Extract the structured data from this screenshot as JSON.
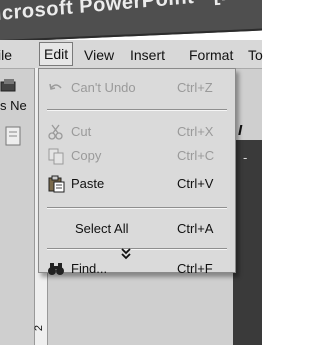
{
  "window": {
    "title": "icrosoft PowerPoint - [Presentat"
  },
  "menubar": {
    "items": [
      {
        "label": "ile"
      },
      {
        "label": "Edit"
      },
      {
        "label": "View"
      },
      {
        "label": "Insert"
      },
      {
        "label": "Format"
      },
      {
        "label": "To"
      }
    ]
  },
  "background": {
    "fragment_ne": "s Ne",
    "fragment_i": "I",
    "fragment_b": "b",
    "fragment_dash": "-",
    "ruler_digit": "2"
  },
  "edit_menu": {
    "items": [
      {
        "label": "Can't Undo",
        "shortcut": "Ctrl+Z",
        "enabled": false,
        "icon": "undo-icon"
      },
      {
        "label": "Cut",
        "shortcut": "Ctrl+X",
        "enabled": false,
        "icon": "scissors-icon"
      },
      {
        "label": "Copy",
        "shortcut": "Ctrl+C",
        "enabled": false,
        "icon": "copy-icon"
      },
      {
        "label": "Paste",
        "shortcut": "Ctrl+V",
        "enabled": true,
        "icon": "clipboard-icon"
      },
      {
        "label": "Select All",
        "shortcut": "Ctrl+A",
        "enabled": true,
        "icon": ""
      },
      {
        "label": "Find...",
        "shortcut": "Ctrl+F",
        "enabled": true,
        "icon": "binoculars-icon"
      }
    ],
    "expand_icon": "expand-arrows-icon"
  },
  "colors": {
    "titlebar": "#4f4f4f",
    "menubar": "#d8d8d8",
    "menu_bg": "#dadada",
    "disabled_text": "#9a9a9a"
  }
}
